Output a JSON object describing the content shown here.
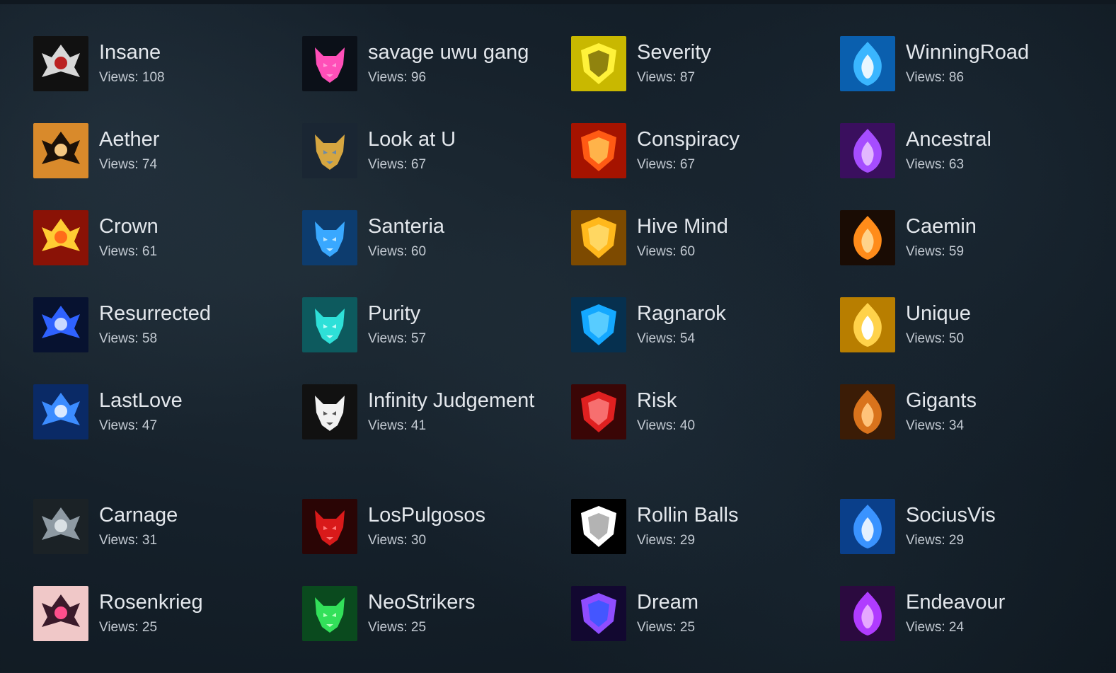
{
  "teams": [
    {
      "name": "Insane",
      "views": "Views: 108",
      "icon": "demon-horns-logo-icon",
      "colors": [
        "#111111",
        "#d8d8d8",
        "#bb2222"
      ]
    },
    {
      "name": "savage uwu gang",
      "views": "Views: 96",
      "icon": "pink-skull-mask-logo-icon",
      "colors": [
        "#0b1018",
        "#ff4fb8",
        "#ff9ad8"
      ]
    },
    {
      "name": "Severity",
      "views": "Views: 87",
      "icon": "yellow-lion-logo-icon",
      "colors": [
        "#c9b800",
        "#fff23a",
        "#6b5d00"
      ]
    },
    {
      "name": "WinningRoad",
      "views": "Views: 86",
      "icon": "blue-lion-logo-icon",
      "colors": [
        "#0a5fae",
        "#3ab6ff",
        "#e8f6ff"
      ]
    },
    {
      "name": "Aether",
      "views": "Views: 74",
      "icon": "tiger-logo-icon",
      "colors": [
        "#d98a2b",
        "#1c1108",
        "#f5c781"
      ]
    },
    {
      "name": "Look at U",
      "views": "Views: 67",
      "icon": "hooded-reaper-logo-icon",
      "colors": [
        "#1a2633",
        "#d6a640",
        "#6c8ba8"
      ]
    },
    {
      "name": "Conspiracy",
      "views": "Views: 67",
      "icon": "red-dragon-logo-icon",
      "colors": [
        "#a51300",
        "#ff5a14",
        "#ffd15c"
      ]
    },
    {
      "name": "Ancestral",
      "views": "Views: 63",
      "icon": "purple-wolf-logo-icon",
      "colors": [
        "#3a0f5e",
        "#a64dff",
        "#e2b7ff"
      ]
    },
    {
      "name": "Crown",
      "views": "Views: 61",
      "icon": "golden-crown-logo-icon",
      "colors": [
        "#8a1206",
        "#ffcc33",
        "#ff6b1a"
      ]
    },
    {
      "name": "Santeria",
      "views": "Views: 60",
      "icon": "blue-serpent-logo-icon",
      "colors": [
        "#0d3c6e",
        "#39a8ff",
        "#bfe8ff"
      ]
    },
    {
      "name": "Hive Mind",
      "views": "Views: 60",
      "icon": "golden-bee-logo-icon",
      "colors": [
        "#7d4a00",
        "#ffb81c",
        "#ffe27a"
      ]
    },
    {
      "name": "Caemin",
      "views": "Views: 59",
      "icon": "winged-phoenix-logo-icon",
      "colors": [
        "#1a0c04",
        "#ff8c1a",
        "#ffd38a"
      ]
    },
    {
      "name": "Resurrected",
      "views": "Views: 58",
      "icon": "blue-wings-monogram-logo-icon",
      "colors": [
        "#071230",
        "#2f62ff",
        "#c9d8ff"
      ]
    },
    {
      "name": "Purity",
      "views": "Views: 57",
      "icon": "teal-phoenix-logo-icon",
      "colors": [
        "#0d5a5e",
        "#2ee0d8",
        "#bffcf8"
      ]
    },
    {
      "name": "Ragnarok",
      "views": "Views: 54",
      "icon": "blue-wolf-head-logo-icon",
      "colors": [
        "#06304f",
        "#14a8ff",
        "#6fd8ff"
      ]
    },
    {
      "name": "Unique",
      "views": "Views: 50",
      "icon": "gold-bird-uq-logo-icon",
      "colors": [
        "#b87e00",
        "#ffd24a",
        "#ffffff"
      ]
    },
    {
      "name": "LastLove",
      "views": "Views: 47",
      "icon": "blue-wolf-shield-logo-icon",
      "colors": [
        "#0a2a66",
        "#3c8cff",
        "#dbe9ff"
      ]
    },
    {
      "name": "Infinity Judgement",
      "views": "Views: 41",
      "icon": "black-shield-logo-icon",
      "colors": [
        "#111111",
        "#f2f2f2",
        "#555555"
      ]
    },
    {
      "name": "Risk",
      "views": "Views: 40",
      "icon": "red-winged-skull-logo-icon",
      "colors": [
        "#3a0606",
        "#e02020",
        "#ff8a8a"
      ]
    },
    {
      "name": "Gigants",
      "views": "Views: 34",
      "icon": "orange-griffin-logo-icon",
      "colors": [
        "#3b1c06",
        "#d9731c",
        "#ffc37a"
      ]
    },
    {
      "name": "Carnage",
      "views": "Views: 31",
      "icon": "grey-carnage-text-logo-icon",
      "colors": [
        "#1b2226",
        "#8e9aa3",
        "#d9e0e4"
      ]
    },
    {
      "name": "LosPulgosos",
      "views": "Views: 30",
      "icon": "red-fist-badge-logo-icon",
      "colors": [
        "#2a0505",
        "#d91a1a",
        "#ff7a7a"
      ]
    },
    {
      "name": "Rollin Balls",
      "views": "Views: 29",
      "icon": "crosshair-logo-icon",
      "colors": [
        "#000000",
        "#ffffff",
        "#9a9a9a"
      ]
    },
    {
      "name": "SociusVis",
      "views": "Views: 29",
      "icon": "blue-winged-crest-logo-icon",
      "colors": [
        "#0a3f8a",
        "#3a93ff",
        "#e4f0ff"
      ]
    },
    {
      "name": "Rosenkrieg",
      "views": "Views: 25",
      "icon": "rose-eye-logo-icon",
      "colors": [
        "#f0c8c8",
        "#3a1a2a",
        "#ff4f8c"
      ]
    },
    {
      "name": "NeoStrikers",
      "views": "Views: 25",
      "icon": "green-emblem-logo-icon",
      "colors": [
        "#0a4a1e",
        "#33e05a",
        "#b8ffbf"
      ]
    },
    {
      "name": "Dream",
      "views": "Views: 25",
      "icon": "purple-tree-logo-icon",
      "colors": [
        "#120830",
        "#8f4dff",
        "#2b5aff"
      ]
    },
    {
      "name": "Endeavour",
      "views": "Views: 24",
      "icon": "purple-butterfly-logo-icon",
      "colors": [
        "#2b0a3f",
        "#b03cff",
        "#e6a8ff"
      ]
    }
  ]
}
